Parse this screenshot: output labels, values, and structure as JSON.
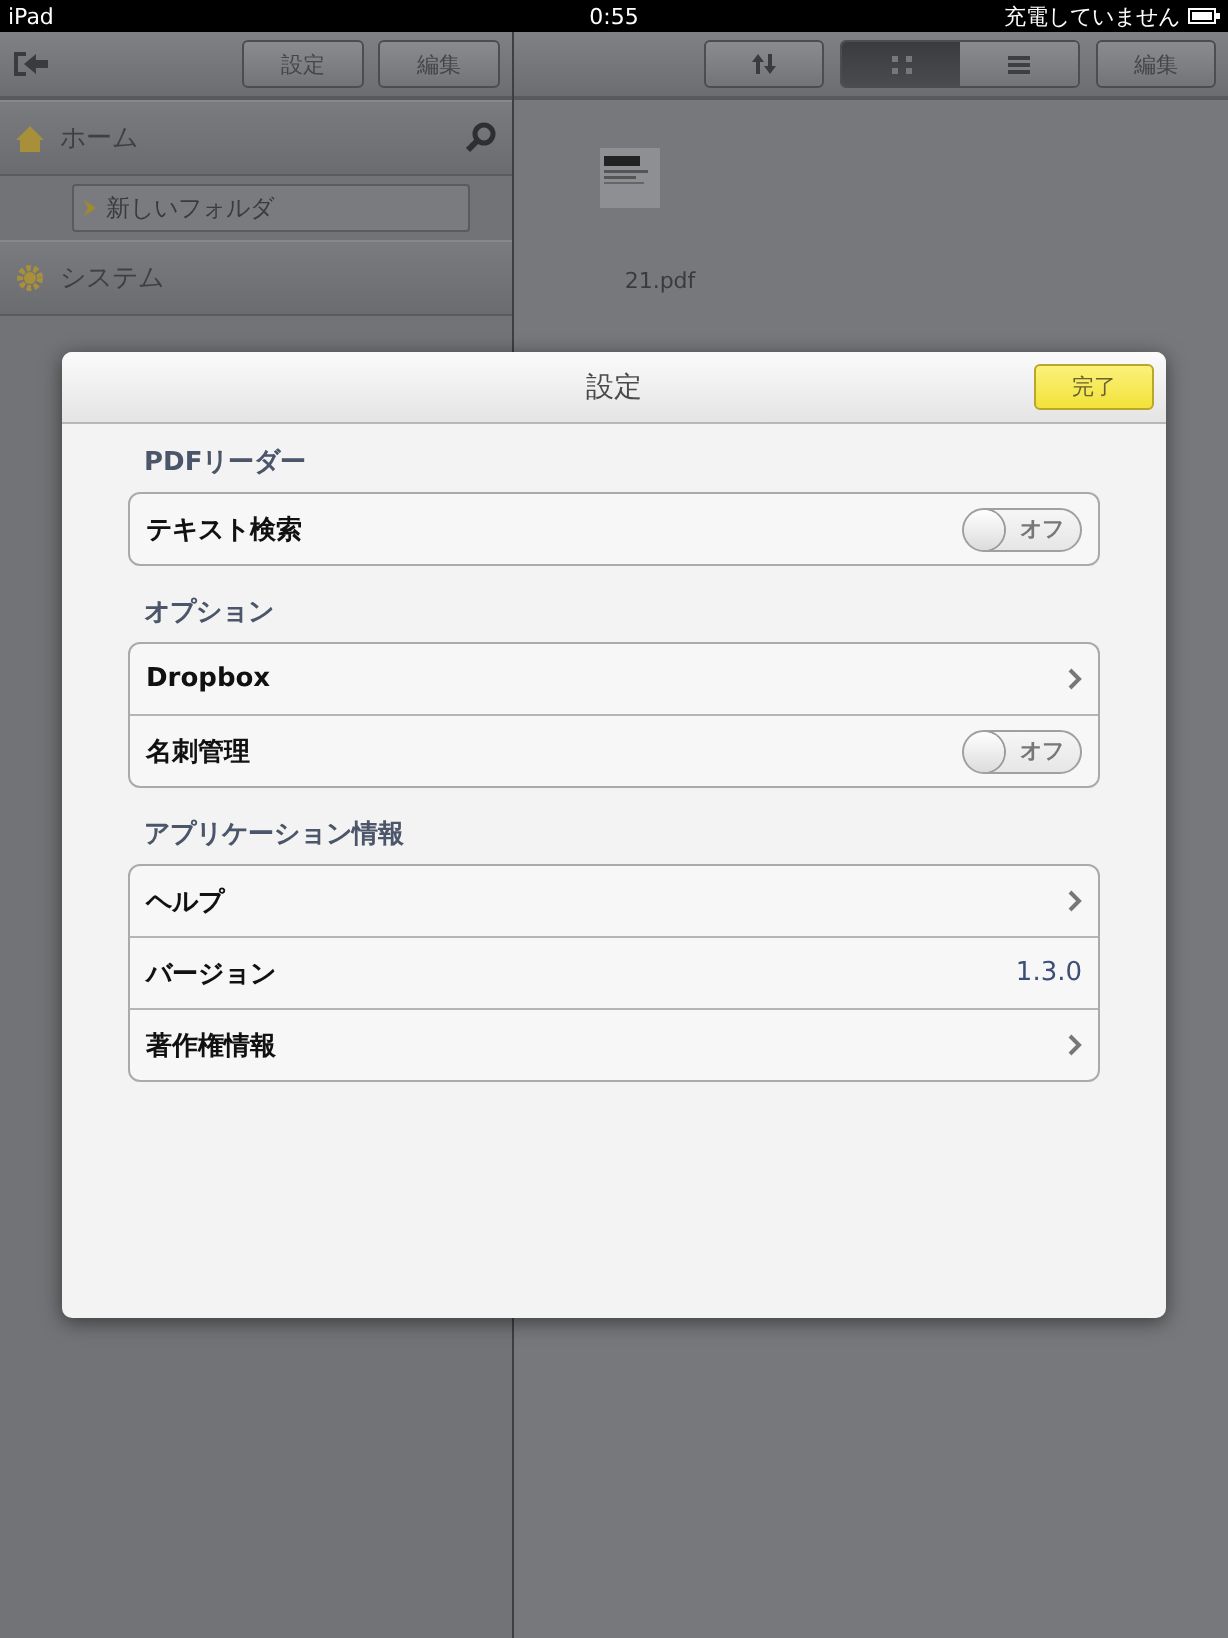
{
  "status_bar": {
    "device": "iPad",
    "time": "0:55",
    "battery_text": "充電していません"
  },
  "sidebar": {
    "buttons": [
      "設定",
      "編集"
    ],
    "sections": [
      {
        "kind": "home",
        "label": "ホーム",
        "children": [
          {
            "label": "新しいフォルダ"
          }
        ]
      },
      {
        "kind": "system",
        "label": "システム"
      }
    ]
  },
  "content": {
    "view_modes": [
      {
        "kind": "grid",
        "selected": true
      },
      {
        "kind": "list",
        "selected": false
      }
    ],
    "edit_button": "編集",
    "files": [
      {
        "name": "21.pdf",
        "kind": "picture"
      }
    ]
  },
  "dialog": {
    "title": "設定",
    "done_button": "完了",
    "groups": [
      {
        "header": "PDFリーダー",
        "rows": [
          {
            "kind": "switch",
            "label": "テキスト検索",
            "on": false,
            "switch_text": "オフ"
          }
        ]
      },
      {
        "header": "オプション",
        "rows": [
          {
            "kind": "link",
            "label": "Dropbox"
          },
          {
            "kind": "switch",
            "label": "名刺管理",
            "on": false,
            "switch_text": "オフ"
          }
        ]
      },
      {
        "header": "アプリケーション情報",
        "rows": [
          {
            "kind": "link",
            "label": "ヘルプ"
          },
          {
            "kind": "value",
            "label": "バージョン",
            "value": "1.3.0"
          },
          {
            "kind": "link",
            "label": "著作権情報"
          }
        ]
      }
    ]
  }
}
